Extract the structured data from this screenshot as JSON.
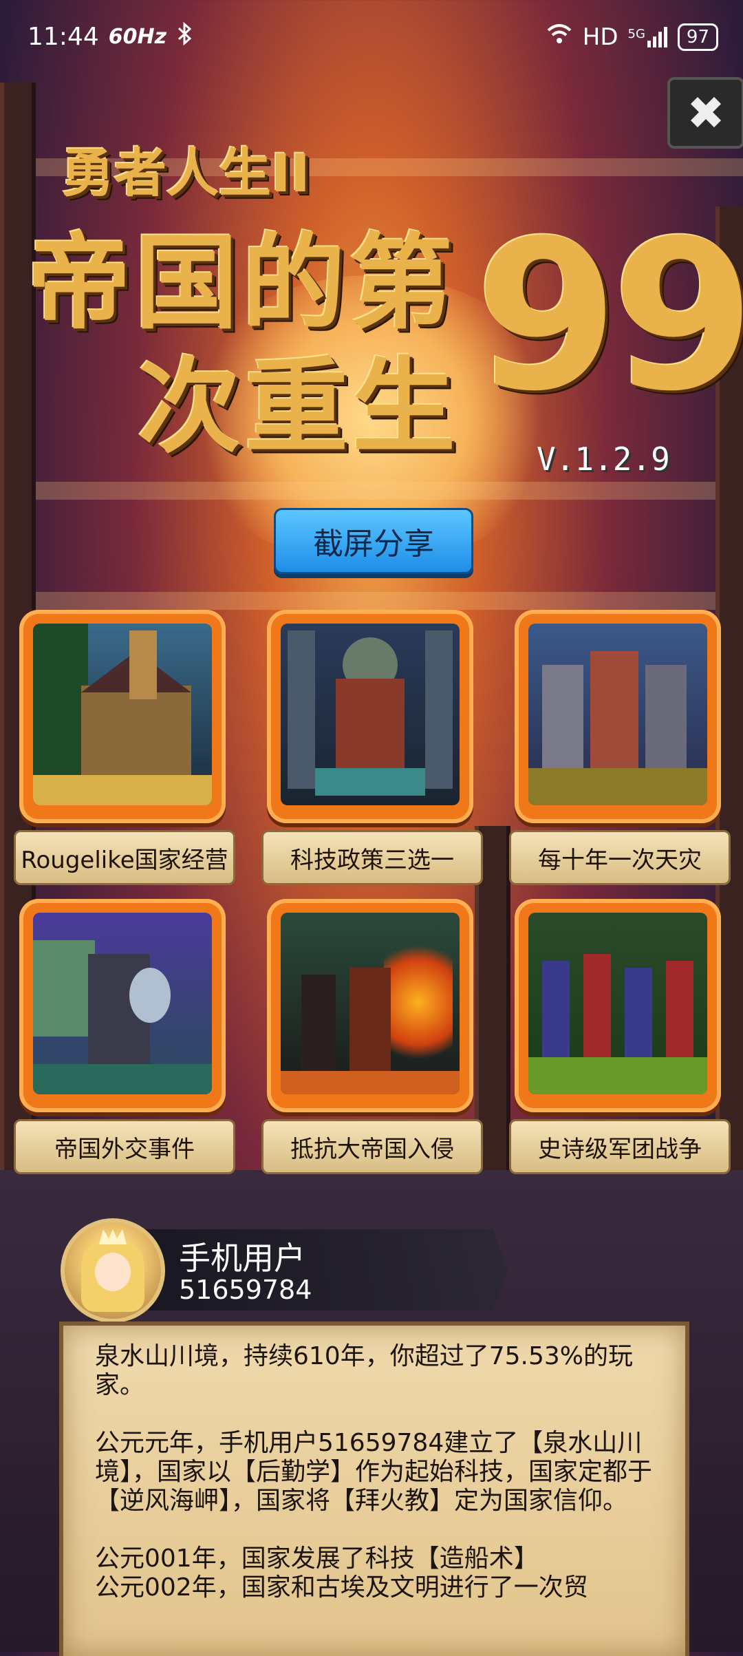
{
  "status": {
    "time": "11:44",
    "refresh": "60Hz",
    "network": "HD",
    "signal": "5G",
    "battery": "97"
  },
  "game": {
    "subtitle": "勇者人生II",
    "title_line1": "帝国的第",
    "title_line2": "次重生",
    "title_number": "99",
    "version": "V.1.2.9"
  },
  "share_button": "截屏分享",
  "features": [
    {
      "label": "Rougelike国家经营",
      "image": "village-image"
    },
    {
      "label": "科技政策三选一",
      "image": "statue-image"
    },
    {
      "label": "每十年一次天灾",
      "image": "knights-battle-image"
    },
    {
      "label": "帝国外交事件",
      "image": "knight-image"
    },
    {
      "label": "抵抗大帝国入侵",
      "image": "burning-city-image"
    },
    {
      "label": "史诗级军团战争",
      "image": "army-march-image"
    }
  ],
  "user": {
    "name": "手机用户",
    "id": "51659784"
  },
  "report": {
    "p1": "泉水山川境，持续610年，你超过了75.53%的玩家。",
    "p2": "公元元年，手机用户51659784建立了【泉水山川境】，国家以【后勤学】作为起始科技，国家定都于【逆风海岬】，国家将【拜火教】定为国家信仰。",
    "p3": "公元001年，国家发展了科技【造船术】",
    "p4": "公元002年，国家和古埃及文明进行了一次贸"
  }
}
